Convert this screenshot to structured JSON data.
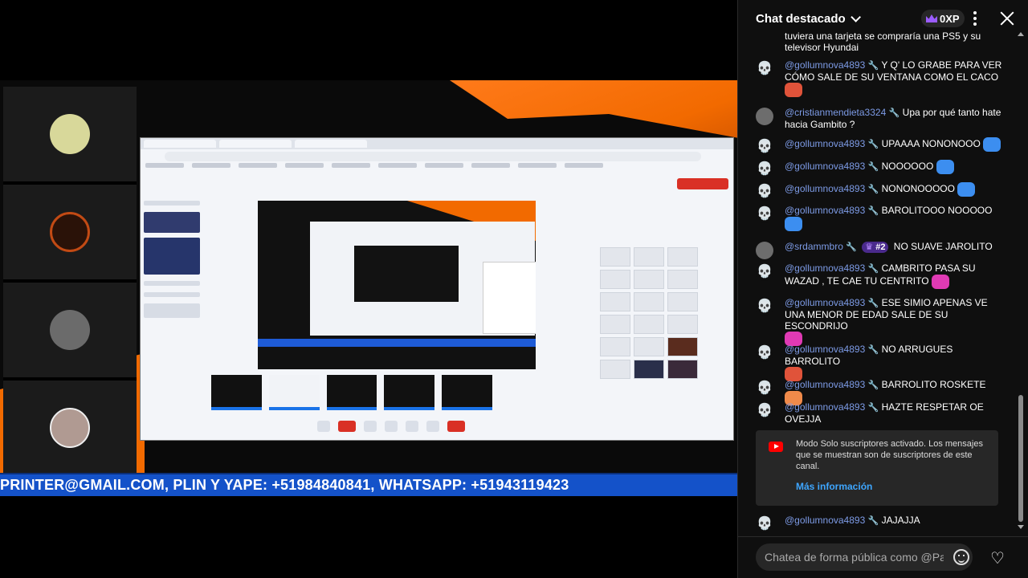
{
  "stream": {
    "ticker_text": "PRINTER@GMAIL.COM, PLIN Y YAPE: +51984840841, WHATSAPP: +51943119423"
  },
  "chat": {
    "title": "Chat destacado",
    "xp": "0XP",
    "top_partial": "tuviera una tarjeta se compraría una PS5 y su televisor Hyundai",
    "messages": [
      {
        "author": "@gollumnova4893",
        "text": "Y Q' LO GRABE PARA VER CÓMO SALE DE SU VENTANA COMO EL CACO",
        "emote": "red"
      },
      {
        "author": "@cristianmendieta3324",
        "text": "Upa por qué tanto hate hacia Gambito ?",
        "emote": ""
      },
      {
        "author": "@gollumnova4893",
        "text": "UPAAAA NONONOOO",
        "emote": "blue"
      },
      {
        "author": "@gollumnova4893",
        "text": "NOOOOOO",
        "emote": "blue"
      },
      {
        "author": "@gollumnova4893",
        "text": "NONONOOOOO",
        "emote": "blue"
      },
      {
        "author": "@gollumnova4893",
        "text": "BAROLITOOO NOOOOO",
        "emote": "blue"
      },
      {
        "author": "@srdammbro",
        "rank": "#2",
        "text": "NO SUAVE JAROLITO",
        "emote": ""
      },
      {
        "author": "@gollumnova4893",
        "text": "CAMBRITO PASA SU WAZAD , TE CAE TU CENTRITO",
        "emote": "pink"
      },
      {
        "author": "@gollumnova4893",
        "text": "ESE SIMIO APENAS VE UNA MENOR DE EDAD SALE DE SU ESCONDRIJO",
        "emote": "pink"
      },
      {
        "author": "@gollumnova4893",
        "text": "NO ARRUGUES BARROLITO",
        "emote": "red"
      },
      {
        "author": "@gollumnova4893",
        "text": "BARROLITO ROSKETE",
        "emote": "orange"
      },
      {
        "author": "@gollumnova4893",
        "text": "HAZTE RESPETAR OE OVEJJA",
        "emote": ""
      }
    ],
    "notice": {
      "text": "Modo Solo suscriptores activado. Los mensajes que se muestran son de suscriptores de este canal.",
      "link": "Más información"
    },
    "last_message": {
      "author": "@gollumnova4893",
      "text": "JAJAJJA"
    },
    "input_placeholder": "Chatea de forma pública como @Paul...",
    "icons": {
      "skull": "skull-avatar-icon",
      "wrench": "wrench-icon",
      "crown": "crown-icon"
    }
  }
}
